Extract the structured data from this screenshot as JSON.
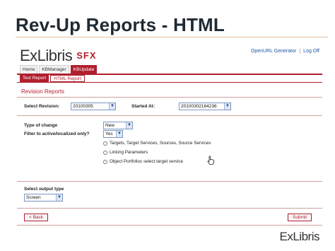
{
  "slide": {
    "title": "Rev-Up Reports - HTML",
    "footer_logo": "ExLibris"
  },
  "app": {
    "logo_word": "ExLibris",
    "logo_product": "SFX",
    "toplinks": {
      "openurl": "OpenURL Generator",
      "separator": "|",
      "logoff": "Log Off"
    },
    "nav_tabs": [
      "Home",
      "KBManager",
      "KBUpdate"
    ],
    "sub_tabs": [
      "Text Report",
      "HTML Report"
    ]
  },
  "form": {
    "section_title": "Revision Reports",
    "select_revision_label": "Select Revision:",
    "select_revision_value": "20100305",
    "started_at_label": "Started At:",
    "started_at_value": "20100302164236",
    "type_of_change_label": "Type of change",
    "type_of_change_value": "New",
    "filter_label": "Filter to active/localized only?",
    "filter_value": "Yes",
    "radio_options": [
      "Targets, Target Services, Sources, Source Services",
      "Linking Parameters",
      "Object Portfolios select target service"
    ],
    "output_type_label": "Select output type",
    "output_type_value": "Screen",
    "back_button": "< Back",
    "submit_button": "Submit"
  },
  "icons": {
    "dropdown": "chevron-down-icon",
    "cursor": "hand-cursor-icon"
  },
  "colors": {
    "accent": "#b11f2e",
    "link": "#1f55a0",
    "select_border": "#7a96c0"
  }
}
